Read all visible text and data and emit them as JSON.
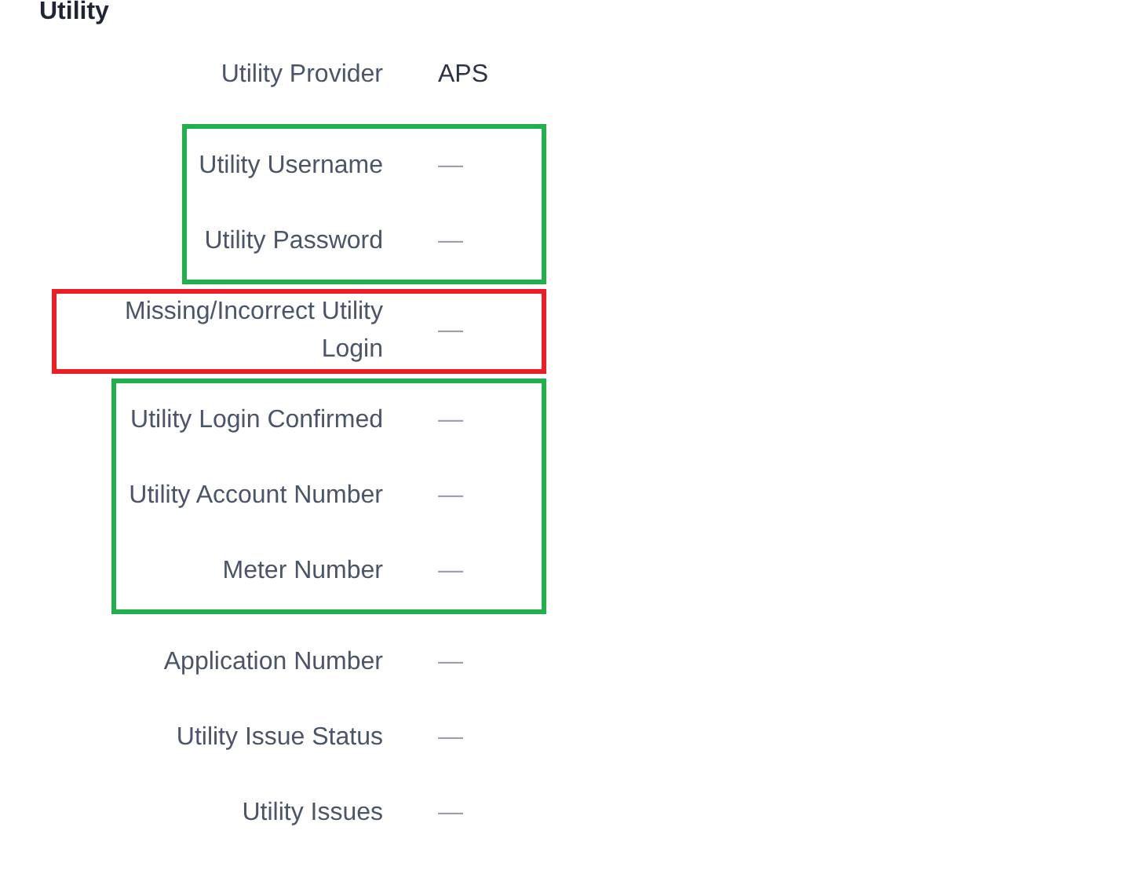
{
  "section": {
    "title": "Utility"
  },
  "groups": [
    {
      "fields": [
        {
          "label": "Utility Provider",
          "value": "APS"
        }
      ]
    },
    {
      "color": "#22b04b",
      "fields": [
        {
          "label": "Utility Username",
          "value": "—"
        },
        {
          "label": "Utility Password",
          "value": "—"
        }
      ]
    },
    {
      "color": "#ee1c25",
      "fields": [
        {
          "label": "Missing/Incorrect Utility Login",
          "value": "—"
        }
      ]
    },
    {
      "color": "#22b04b",
      "fields": [
        {
          "label": "Utility Login Confirmed",
          "value": "—"
        },
        {
          "label": "Utility Account Number",
          "value": "—"
        },
        {
          "label": "Meter Number",
          "value": "—"
        }
      ]
    },
    {
      "fields": [
        {
          "label": "Application Number",
          "value": "—"
        },
        {
          "label": "Utility Issue Status",
          "value": "—"
        },
        {
          "label": "Utility Issues",
          "value": "—"
        }
      ]
    }
  ]
}
